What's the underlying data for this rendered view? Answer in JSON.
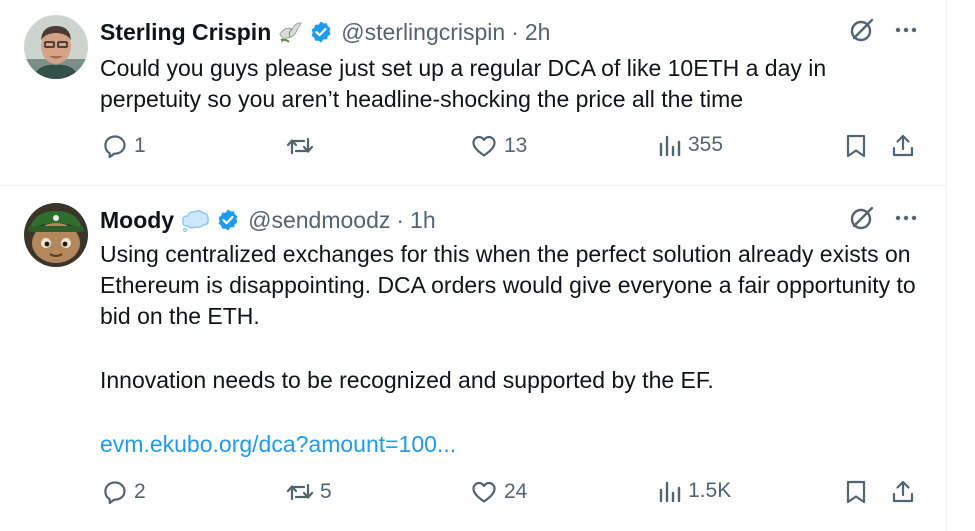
{
  "tweets": [
    {
      "name": "Sterling Crispin",
      "name_emoji": "dove-icon",
      "verified": true,
      "handle": "@sterlingcrispin",
      "separator": "·",
      "time": "2h",
      "text": [
        "Could you guys please just set up a regular DCA of like 10ETH a day in perpetuity so you aren’t headline-shocking the price all the time"
      ],
      "link": "",
      "replies": "1",
      "reposts": "",
      "likes": "13",
      "views": "355"
    },
    {
      "name": "Moody",
      "name_emoji": "thought-bubble-icon",
      "verified": true,
      "handle": "@sendmoodz",
      "separator": "·",
      "time": "1h",
      "text": [
        "Using centralized exchanges for this when the perfect solution already exists on Ethereum is disappointing. DCA orders would give everyone a fair opportunity to bid on the ETH.",
        "Innovation needs to be recognized and supported by the EF."
      ],
      "link": "evm.ekubo.org/dca?amount=100...",
      "replies": "2",
      "reposts": "5",
      "likes": "24",
      "views": "1.5K"
    }
  ],
  "colors": {
    "text": "#0f1419",
    "secondary": "#536471",
    "accent": "#1d9bf0",
    "border": "#eff3f4"
  }
}
